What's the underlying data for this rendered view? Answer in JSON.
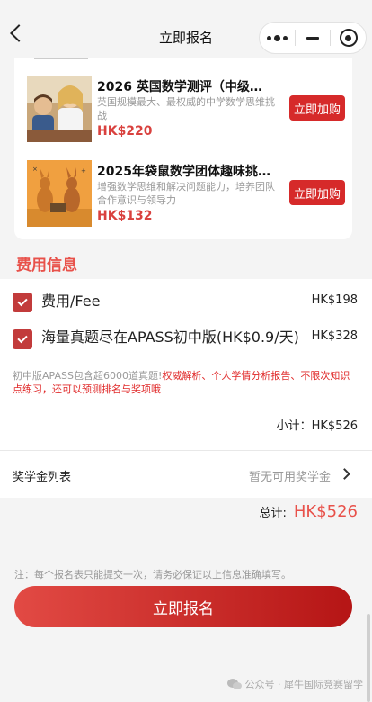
{
  "nav": {
    "title": "立即报名"
  },
  "products": [
    {
      "name": "2026 英国数学测评（中级…",
      "desc": "英国规模最大、最权威的中学数学思维挑战",
      "price": "HK$220",
      "buy_label": "立即加购"
    },
    {
      "name": "2025年袋鼠数学团体趣味挑…",
      "desc": "增强数学思维和解决问题能力，培养团队合作意识与领导力",
      "price": "HK$132",
      "buy_label": "立即加购"
    }
  ],
  "fees": {
    "title": "费用信息",
    "items": [
      {
        "label": "费用/Fee",
        "amount": "HK$198",
        "checked": true
      },
      {
        "label": "海量真题尽在APASS初中版(HK$0.9/天)",
        "amount": "HK$328",
        "checked": true
      }
    ],
    "note_gray": "初中版APASS包含超6000道真题!",
    "note_red": "权威解析、个人学情分析报告、不限次知识点练习，还可以预测排名与奖项哦",
    "subtotal": "小计：HK$526"
  },
  "scholarship": {
    "label": "奖学金列表",
    "value": "暂无可用奖学金"
  },
  "total": {
    "label": "总计:",
    "amount": "HK$526"
  },
  "notice": "注：每个报名表只能提交一次，请务必保证以上信息准确填写。",
  "submit_label": "立即报名",
  "watermark": "公众号 · 犀牛国际竞赛留学",
  "colors": {
    "accent": "#e8514a",
    "button": "#d62a2a"
  }
}
